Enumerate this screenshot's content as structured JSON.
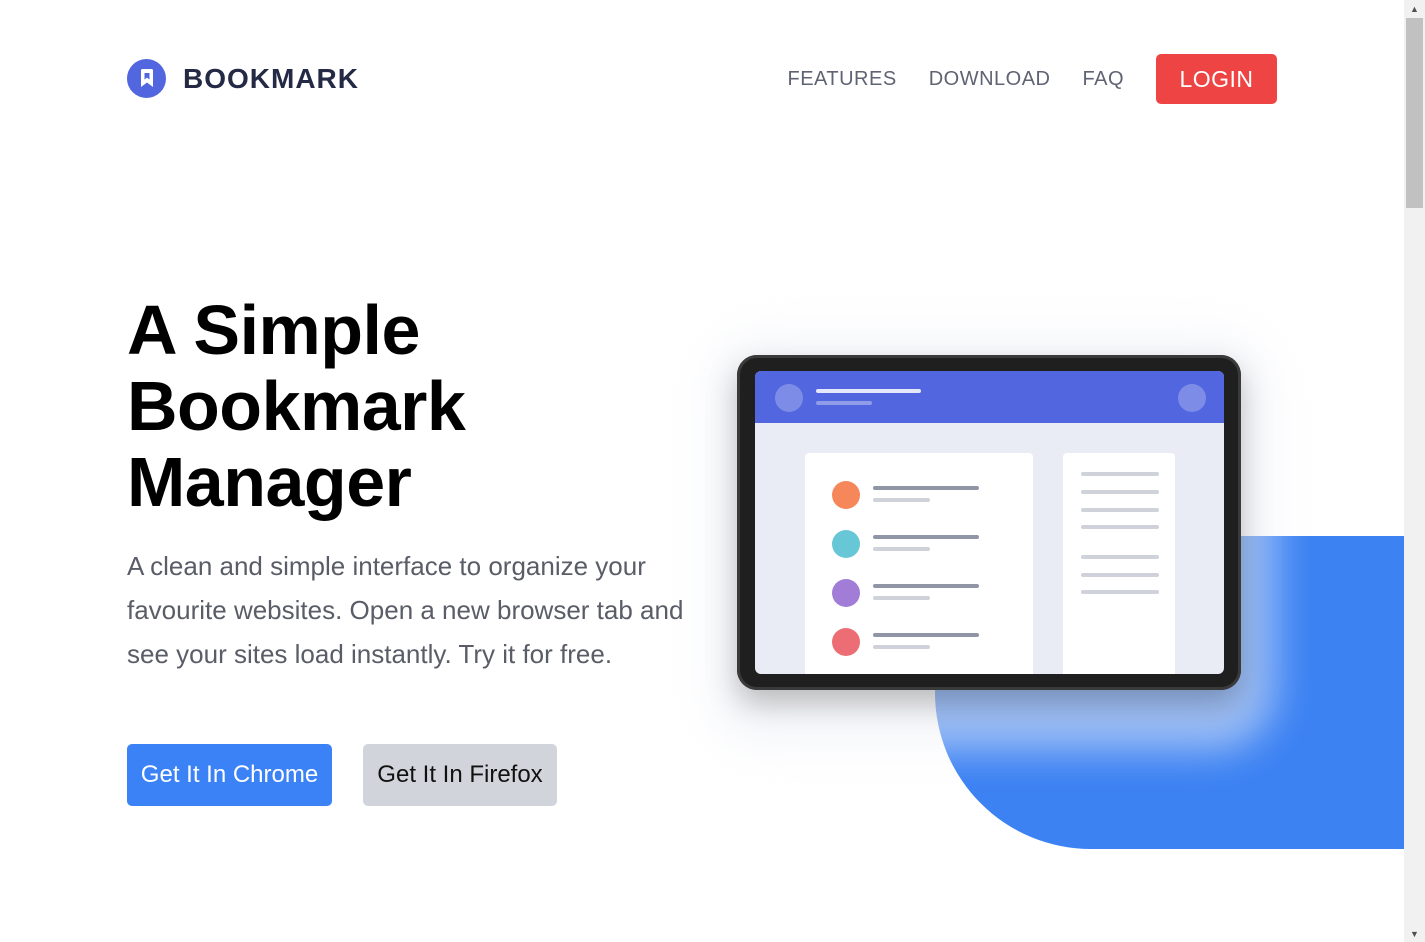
{
  "brand": {
    "name": "BOOKMARK",
    "accent": "#5267df"
  },
  "nav": {
    "items": [
      {
        "label": "FEATURES"
      },
      {
        "label": "DOWNLOAD"
      },
      {
        "label": "FAQ"
      }
    ],
    "login_label": "LOGIN",
    "login_color": "#ef4444"
  },
  "hero": {
    "title": "A Simple Bookmark Manager",
    "description": "A clean and simple interface to organize your favourite websites. Open a new browser tab and see your sites load instantly. Try it for free.",
    "primary_cta": "Get It In Chrome",
    "secondary_cta": "Get It In Firefox",
    "primary_color": "#3b82f6",
    "secondary_color": "#d1d5db"
  },
  "illustration": {
    "bookmark_dot_colors": [
      "#f5875a",
      "#67c7d6",
      "#a17dd8",
      "#ec6e74"
    ]
  }
}
